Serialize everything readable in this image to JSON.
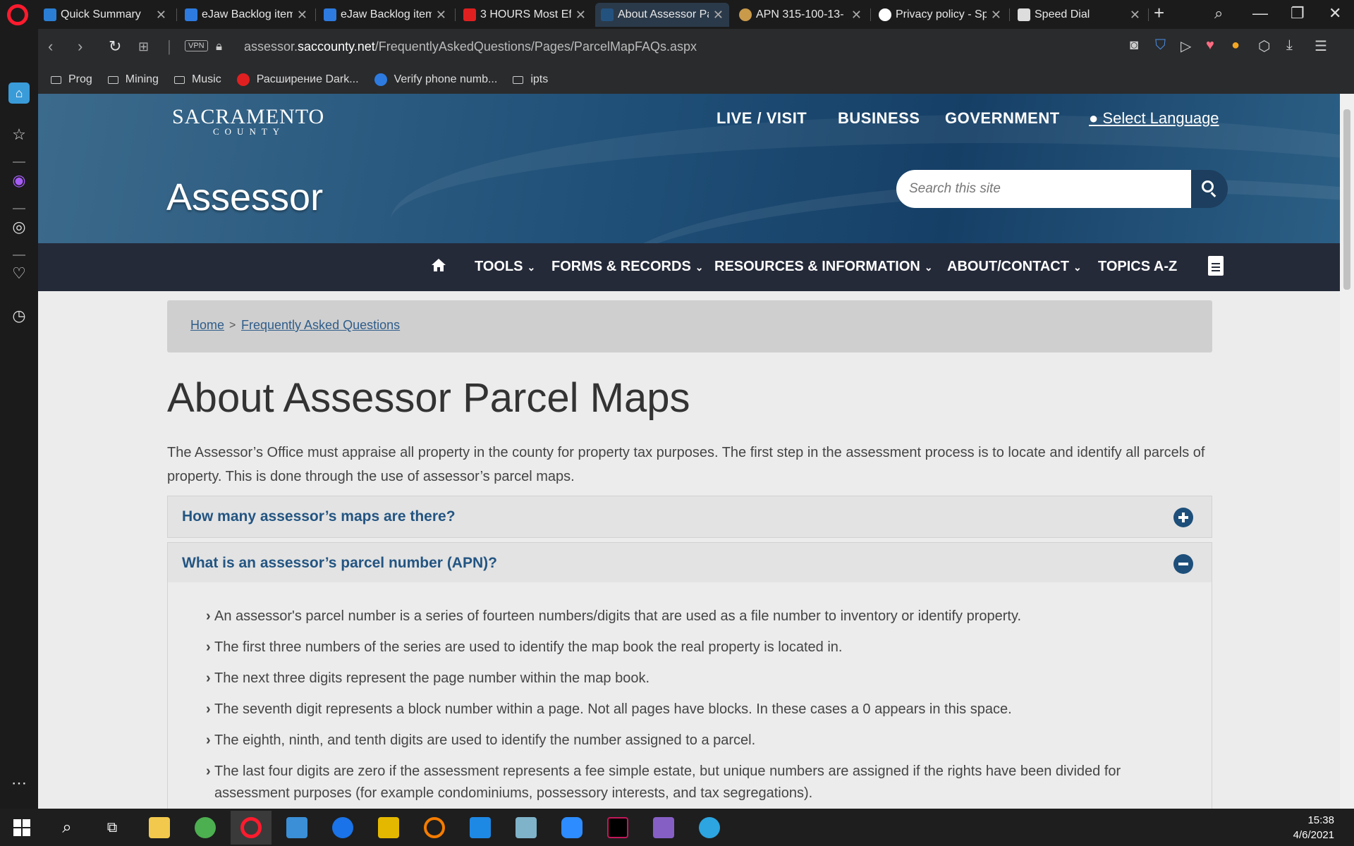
{
  "browser": {
    "tabs": [
      {
        "label": "Quick Summary",
        "color": "#2a7fd4"
      },
      {
        "label": "eJaw Backlog item",
        "color": "#2d7be0"
      },
      {
        "label": "eJaw Backlog item",
        "color": "#2d7be0"
      },
      {
        "label": "3 HOURS Most Eff",
        "color": "#e02020"
      },
      {
        "label": "About Assessor Pa",
        "color": "#24527e"
      },
      {
        "label": "APN 315-100-13-",
        "color": "#c99a4a"
      },
      {
        "label": "Privacy policy - Sp",
        "color": "#ffffff"
      },
      {
        "label": "Speed Dial",
        "color": "#dddddd"
      }
    ],
    "active_tab_index": 4,
    "new_tab_label": "+",
    "vpn_label": "VPN",
    "url_prefix": "assessor.",
    "url_domain": "saccounty.net",
    "url_path": "/FrequentlyAskedQuestions/Pages/ParcelMapFAQs.aspx",
    "bookmarks": [
      {
        "label": "Prog",
        "type": "folder"
      },
      {
        "label": "Mining",
        "type": "folder"
      },
      {
        "label": "Music",
        "type": "folder"
      },
      {
        "label": "Расширение Dark...",
        "type": "site",
        "color": "#e02020"
      },
      {
        "label": "Verify phone numb...",
        "type": "site",
        "color": "#2d7be0"
      },
      {
        "label": "ipts",
        "type": "folder"
      }
    ]
  },
  "site": {
    "logo_line1": "SACRAMENTO",
    "logo_line2": "COUNTY",
    "top_nav": [
      "LIVE / VISIT",
      "BUSINESS",
      "GOVERNMENT"
    ],
    "language_link": "Select Language",
    "department": "Assessor",
    "search_placeholder": "Search this site",
    "main_nav": [
      "TOOLS",
      "FORMS & RECORDS",
      "RESOURCES & INFORMATION",
      "ABOUT/CONTACT",
      "TOPICS A-Z"
    ],
    "breadcrumb": {
      "home": "Home",
      "separator": ">",
      "current": "Frequently Asked Questions"
    },
    "title": "About Assessor Parcel Maps",
    "intro": "The Assessor’s Office must appraise all property in the county for property tax purposes. The first step in the assessment process is to locate and identify all parcels of property. This is done through the use of assessor’s parcel maps.",
    "faq": [
      {
        "question": "How many assessor’s maps are there?",
        "expanded": false
      },
      {
        "question": "What is an assessor’s parcel number (APN)?",
        "expanded": true
      }
    ],
    "apn_points": [
      "An assessor's parcel number is a series of fourteen numbers/digits that are used as a file number to inventory or identify property.",
      "The first three numbers of the series are used to identify the map book the real property is located in.",
      "The next three digits represent the page number within the map book.",
      "The seventh digit represents a block number within a page. Not all pages have blocks. In these cases a 0 appears in this space.",
      "The eighth, ninth, and tenth digits are used to identify the number assigned to a parcel.",
      "The last four digits are zero if the assessment represents a fee simple estate, but unique numbers are assigned if the rights have been divided for assessment purposes (for example condominiums, possessory interests, and tax segregations)."
    ],
    "colors": {
      "header_blue": "#1f4f77",
      "nav_dark": "#252a39",
      "link": "#235582"
    }
  },
  "taskbar": {
    "time": "15:38",
    "date": "4/6/2021"
  }
}
